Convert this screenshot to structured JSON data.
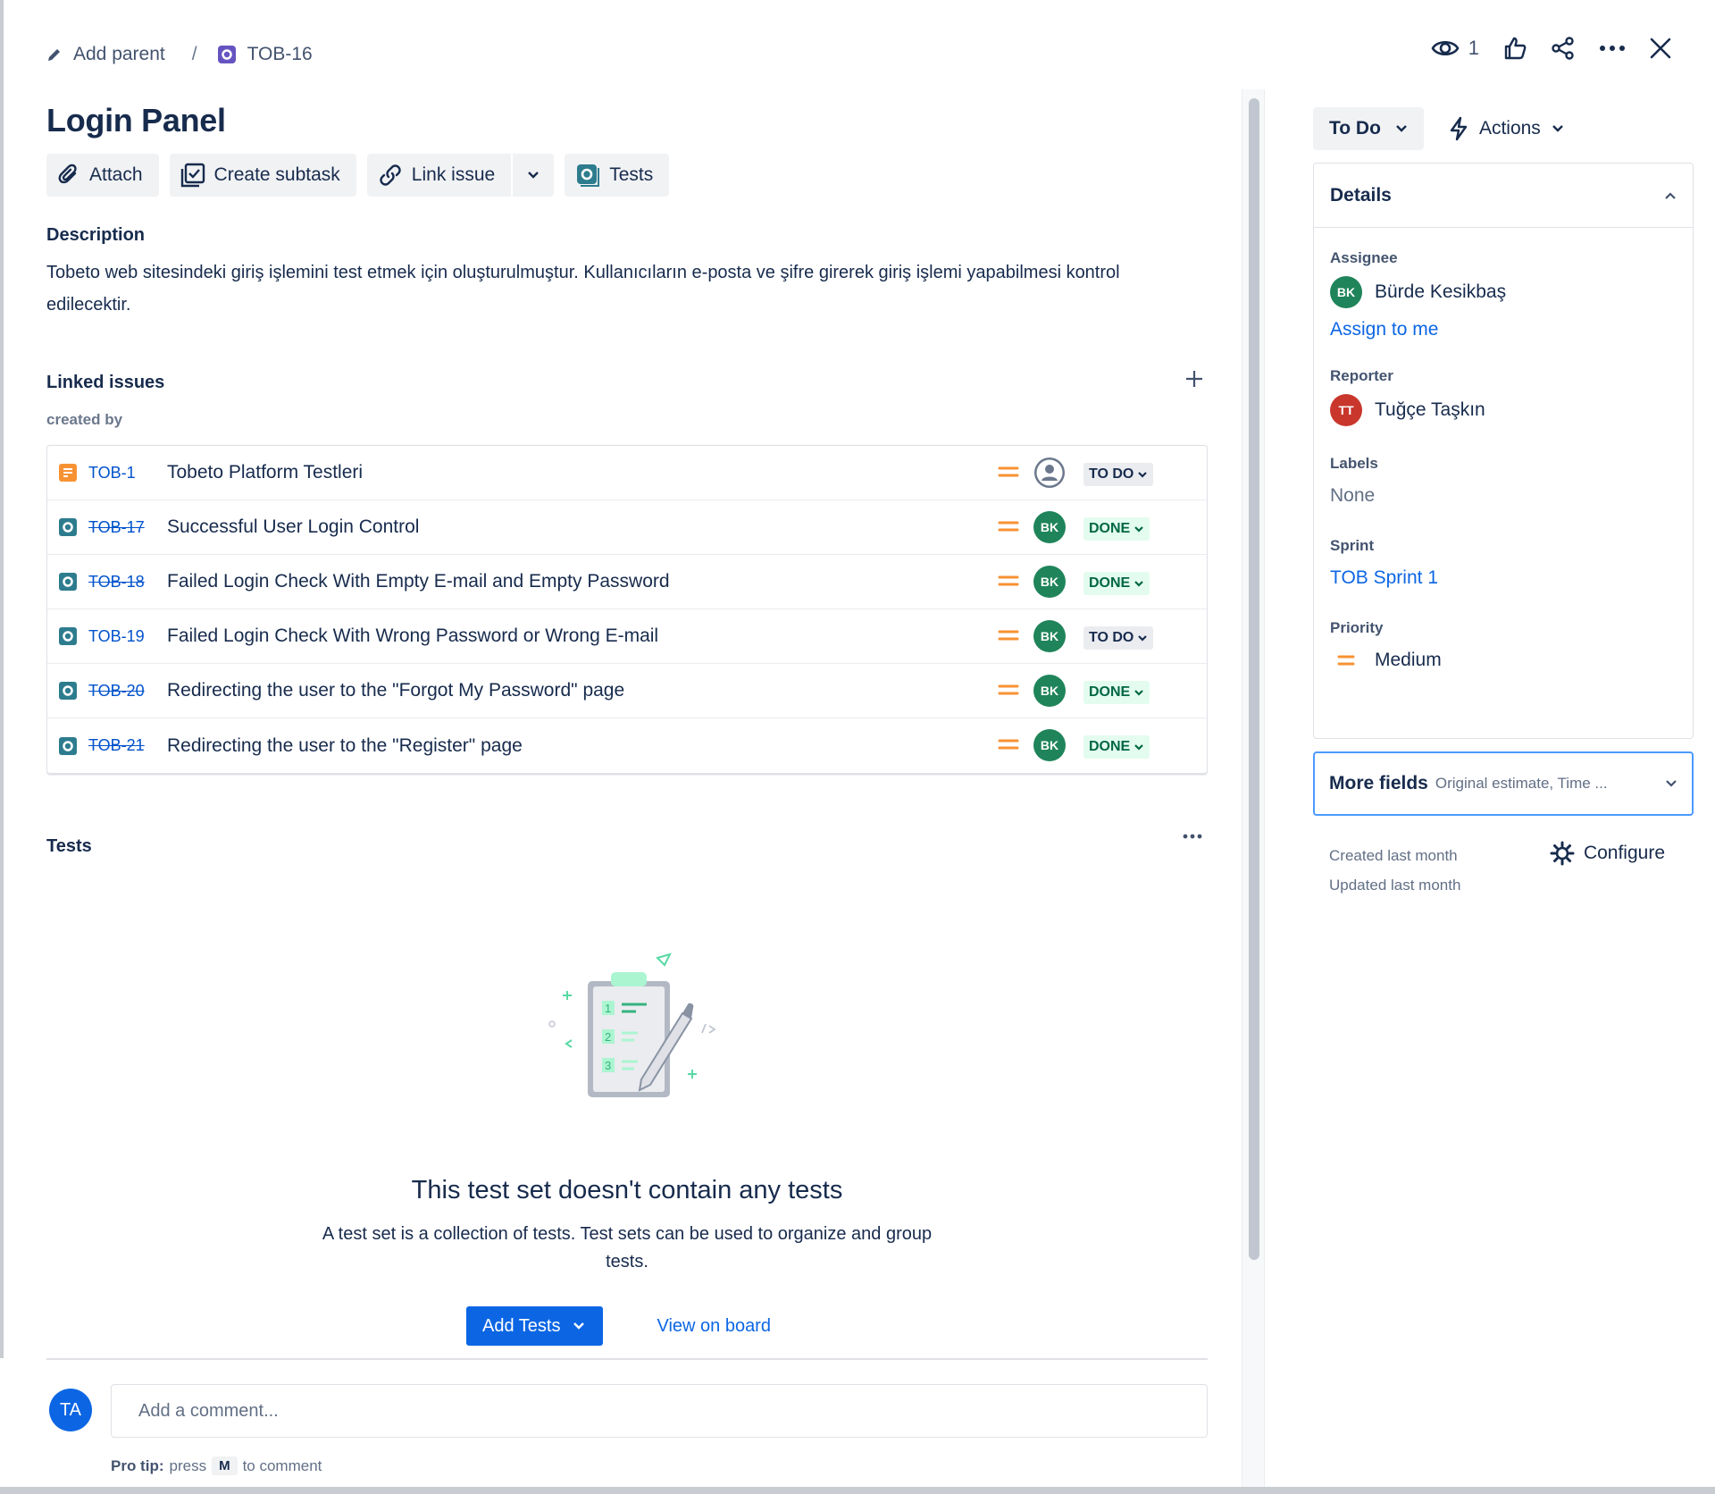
{
  "breadcrumb": {
    "add_parent": "Add parent",
    "separator": "/",
    "issue_key": "TOB-16"
  },
  "toolbar": {
    "watchers_count": "1"
  },
  "issue": {
    "title": "Login Panel"
  },
  "actions": {
    "attach": "Attach",
    "create_subtask": "Create subtask",
    "link_issue": "Link issue",
    "tests": "Tests"
  },
  "description": {
    "heading": "Description",
    "text": "Tobeto web sitesindeki giriş işlemini test etmek için oluşturulmuştur. Kullanıcıların e-posta ve şifre girerek giriş işlemi yapabilmesi kontrol edilecektir."
  },
  "linked_issues": {
    "heading": "Linked issues",
    "relation": "created by",
    "rows": [
      {
        "key": "TOB-1",
        "summary": "Tobeto Platform Testleri",
        "status": "TO DO",
        "resolved": false,
        "assignee_initials": "",
        "type_icon": "story-icon"
      },
      {
        "key": "TOB-17",
        "summary": "Successful User Login Control",
        "status": "DONE",
        "resolved": true,
        "assignee_initials": "BK",
        "type_icon": "test-icon"
      },
      {
        "key": "TOB-18",
        "summary": "Failed Login Check With Empty E-mail and Empty Password",
        "status": "DONE",
        "resolved": true,
        "assignee_initials": "BK",
        "type_icon": "test-icon"
      },
      {
        "key": "TOB-19",
        "summary": "Failed Login Check With Wrong Password or Wrong E-mail",
        "status": "TO DO",
        "resolved": false,
        "assignee_initials": "BK",
        "type_icon": "test-icon"
      },
      {
        "key": "TOB-20",
        "summary": "Redirecting the user to the \"Forgot My Password\" page",
        "status": "DONE",
        "resolved": true,
        "assignee_initials": "BK",
        "type_icon": "test-icon"
      },
      {
        "key": "TOB-21",
        "summary": "Redirecting the user to the \"Register\" page",
        "status": "DONE",
        "resolved": true,
        "assignee_initials": "BK",
        "type_icon": "test-icon"
      }
    ]
  },
  "tests": {
    "heading": "Tests",
    "empty_title": "This test set doesn't contain any tests",
    "empty_text": "A test set is a collection of tests. Test sets can be used to organize and group tests.",
    "add_tests": "Add Tests",
    "view_on_board": "View on board"
  },
  "comment": {
    "avatar_initials": "TA",
    "placeholder": "Add a comment...",
    "pro_tip_label": "Pro tip:",
    "pro_tip_press": "press",
    "pro_tip_key": "M",
    "pro_tip_suffix": "to comment"
  },
  "sidebar": {
    "status": "To Do",
    "actions": "Actions",
    "details_heading": "Details",
    "assignee_label": "Assignee",
    "assignee_name": "Bürde Kesikbaş",
    "assignee_initials": "BK",
    "assign_to_me": "Assign to me",
    "reporter_label": "Reporter",
    "reporter_name": "Tuğçe Taşkın",
    "reporter_initials": "TT",
    "labels_label": "Labels",
    "labels_value": "None",
    "sprint_label": "Sprint",
    "sprint_value": "TOB Sprint 1",
    "priority_label": "Priority",
    "priority_value": "Medium",
    "more_fields": "More fields",
    "more_fields_sub": "Original estimate, Time ...",
    "created": "Created last month",
    "updated": "Updated last month",
    "configure": "Configure"
  },
  "colors": {
    "primary": "#0C66E4",
    "avatar_bk": "#1F845A",
    "avatar_tt": "#C9372C",
    "priority_medium": "#F79233",
    "done_bg": "#E3FCEF",
    "todo_bg": "#EBECF0"
  }
}
